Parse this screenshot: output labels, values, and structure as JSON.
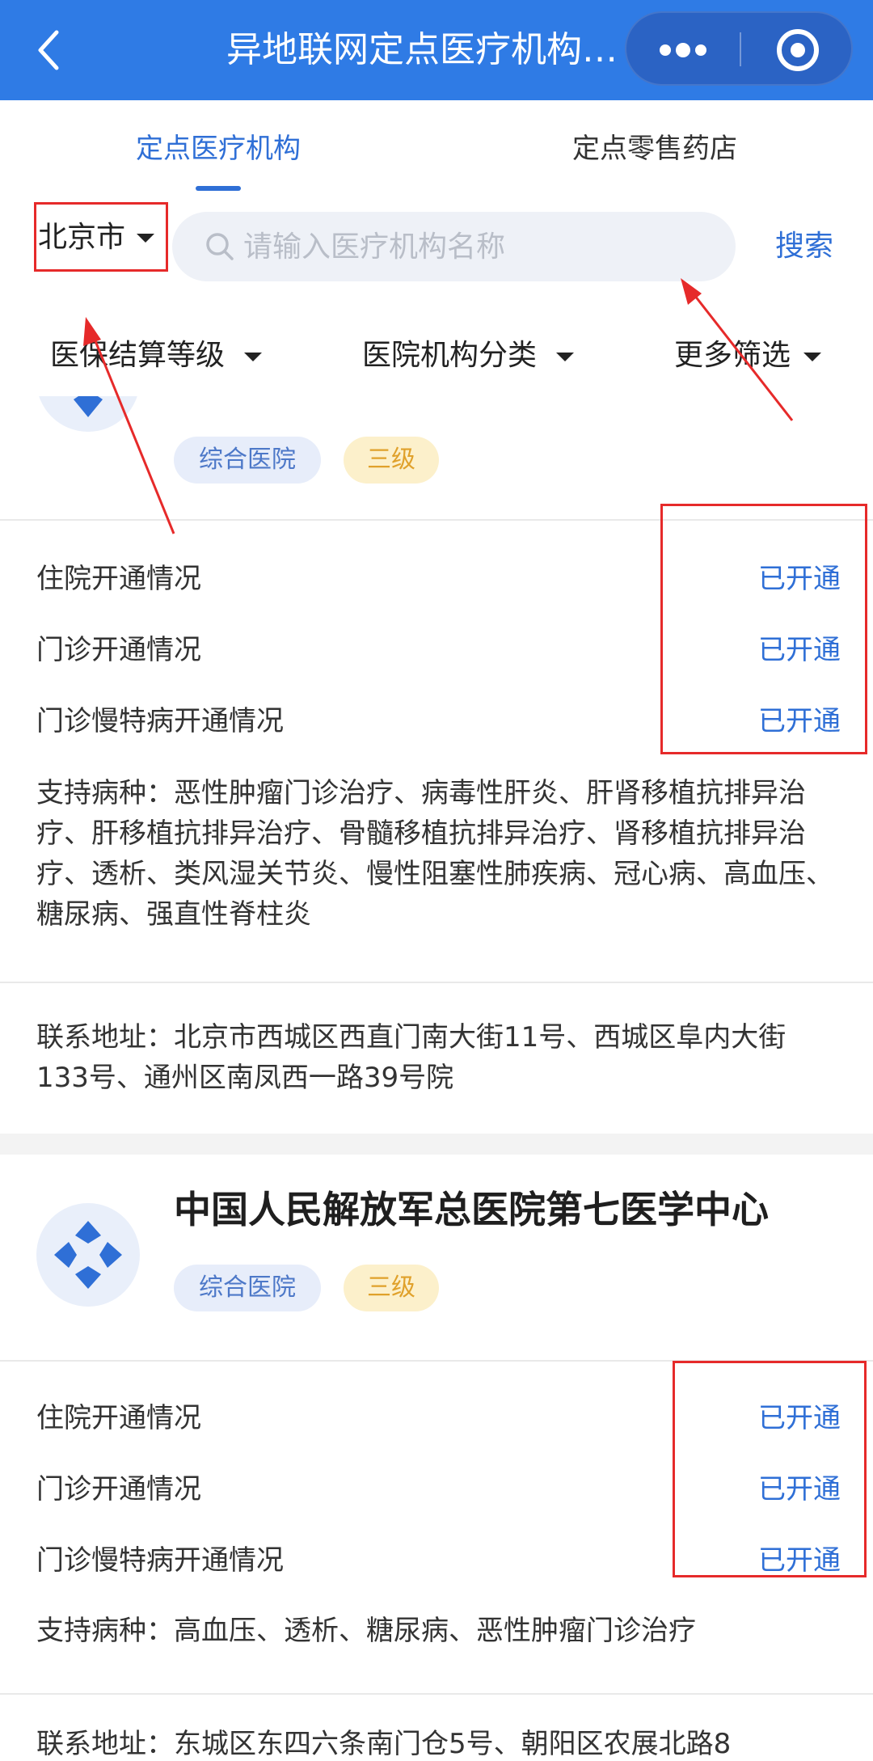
{
  "header": {
    "title": "异地联网定点医疗机构查询",
    "back_icon": "chevron-left-icon",
    "more_icon": "more-dots-icon",
    "close_icon": "target-close-icon",
    "color": "#2f7be5"
  },
  "tabs": [
    {
      "label": "定点医疗机构",
      "active": true
    },
    {
      "label": "定点零售药店",
      "active": false
    }
  ],
  "search": {
    "city": "北京市",
    "placeholder": "请输入医疗机构名称",
    "value": "",
    "button_label": "搜索"
  },
  "filters": [
    {
      "label": "医保结算等级"
    },
    {
      "label": "医院机构分类"
    },
    {
      "label": "更多筛选"
    }
  ],
  "hospitals": [
    {
      "name": "",
      "type_tag": "综合医院",
      "level_tag": "三级",
      "rows": [
        {
          "label": "住院开通情况",
          "value": "已开通"
        },
        {
          "label": "门诊开通情况",
          "value": "已开通"
        },
        {
          "label": "门诊慢特病开通情况",
          "value": "已开通"
        }
      ],
      "diseases": "支持病种：恶性肿瘤门诊治疗、病毒性肝炎、肝肾移植抗排异治疗、肝移植抗排异治疗、骨髓移植抗排异治疗、肾移植抗排异治疗、透析、类风湿关节炎、慢性阻塞性肺疾病、冠心病、高血压、糖尿病、强直性脊柱炎",
      "address": "联系地址：北京市西城区西直门南大街11号、西城区阜内大街133号、通州区南凤西一路39号院"
    },
    {
      "name": "中国人民解放军总医院第七医学中心",
      "type_tag": "综合医院",
      "level_tag": "三级",
      "rows": [
        {
          "label": "住院开通情况",
          "value": "已开通"
        },
        {
          "label": "门诊开通情况",
          "value": "已开通"
        },
        {
          "label": "门诊慢特病开通情况",
          "value": "已开通"
        }
      ],
      "diseases": "支持病种：高血压、透析、糖尿病、恶性肿瘤门诊治疗",
      "address": "联系地址：东城区东四六条南门仓5号、朝阳区农展北路8"
    }
  ],
  "colors": {
    "accent": "#2f6fd6",
    "annotation_red": "#e62a2a",
    "tag_type_bg": "#e7edfa",
    "tag_level_bg": "#fcf0cb"
  }
}
